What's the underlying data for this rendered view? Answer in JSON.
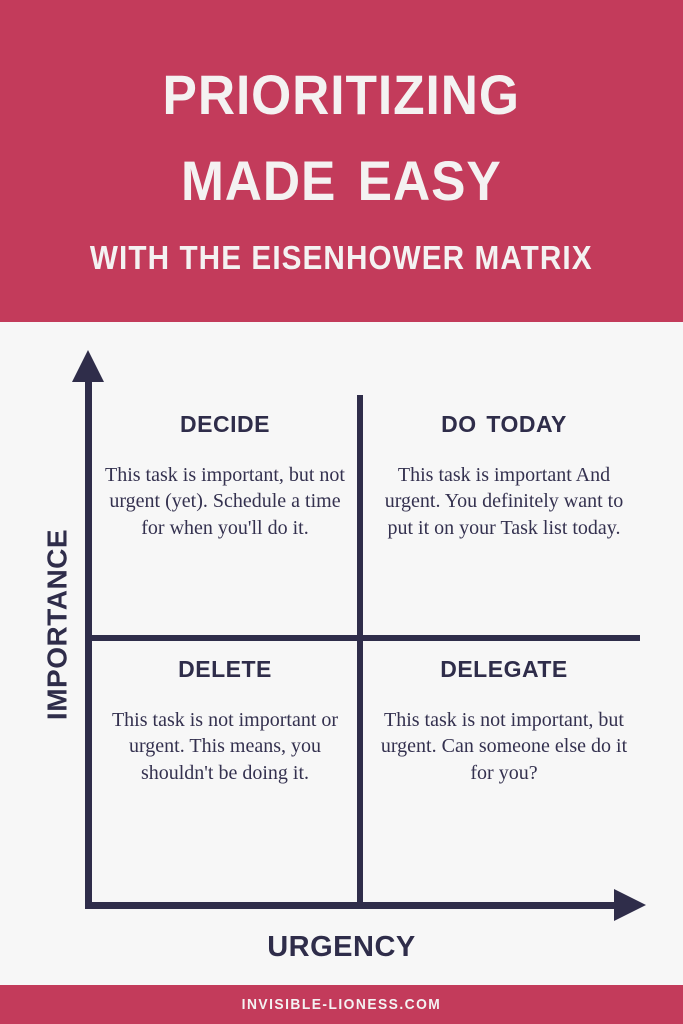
{
  "colors": {
    "brand_red": "#C33B5B",
    "ink_navy": "#2F2D4A",
    "body_text": "#34314F",
    "background": "#F7F7F7",
    "header_text": "#F4F2F2"
  },
  "header": {
    "title_line_1": "Prioritizing",
    "title_line_2": "made easy",
    "subtitle": "with the eisenhower matrix"
  },
  "matrix": {
    "y_axis_label": "Importance",
    "x_axis_label": "Urgency",
    "quadrants": [
      {
        "position": "top-left",
        "heading": "Decide",
        "body": "This task is important, but not urgent (yet). Schedule a time for when you'll do it."
      },
      {
        "position": "top-right",
        "heading": "Do today",
        "body": "This task is important And urgent. You definitely want to put it on your Task list today."
      },
      {
        "position": "bottom-left",
        "heading": "Delete",
        "body": "This task is not important or urgent. This means, you shouldn't be doing it."
      },
      {
        "position": "bottom-right",
        "heading": "Delegate",
        "body": "This task is not important, but urgent. Can someone else do it for you?"
      }
    ]
  },
  "footer": {
    "website": "invisible-lioness.com"
  }
}
